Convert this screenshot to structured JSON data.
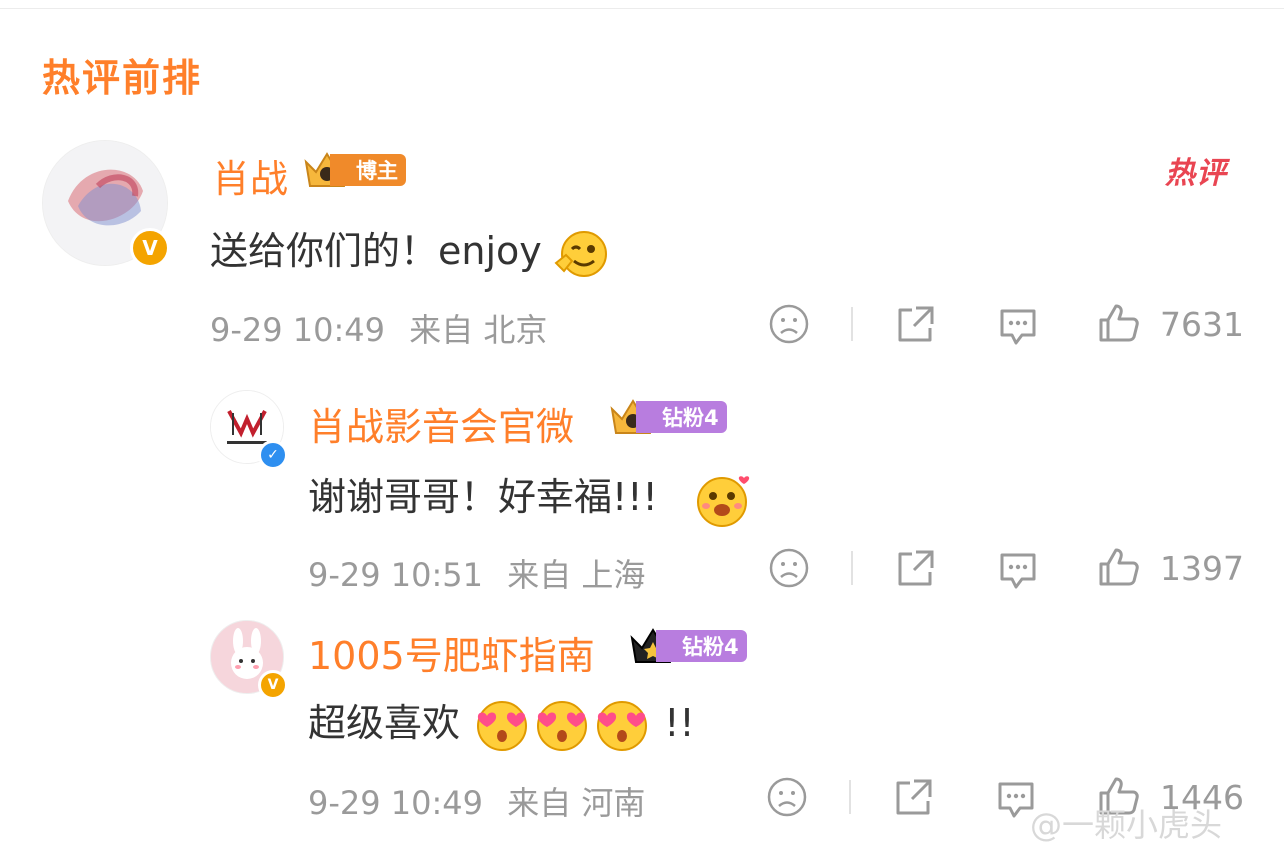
{
  "section_title": "热评前排",
  "hot_tag": "热评",
  "comments": [
    {
      "author": "肖战",
      "badge_label": "博主",
      "badge_level": "10",
      "text": "送给你们的！enjoy",
      "time": "9-29 10:49",
      "source": "来自 北京",
      "likes": "7631"
    },
    {
      "author": "肖战影音会官微",
      "badge_label": "钻粉4",
      "badge_level": "9",
      "text": "谢谢哥哥！好幸福!!!",
      "time": "9-29 10:51",
      "source": "来自 上海",
      "likes": "1397"
    },
    {
      "author": "1005号肥虾指南",
      "badge_label": "钻粉4",
      "badge_level": "1",
      "text": "超级喜欢",
      "text_suffix": "!!",
      "time": "9-29 10:49",
      "source": "来自 河南",
      "likes": "1446"
    }
  ],
  "watermark": "@一颗小虎头",
  "colors": {
    "accent": "#ff7f2a",
    "meta": "#9a9a9a",
    "hot": "#e94552",
    "purple": "#b87ddf"
  }
}
